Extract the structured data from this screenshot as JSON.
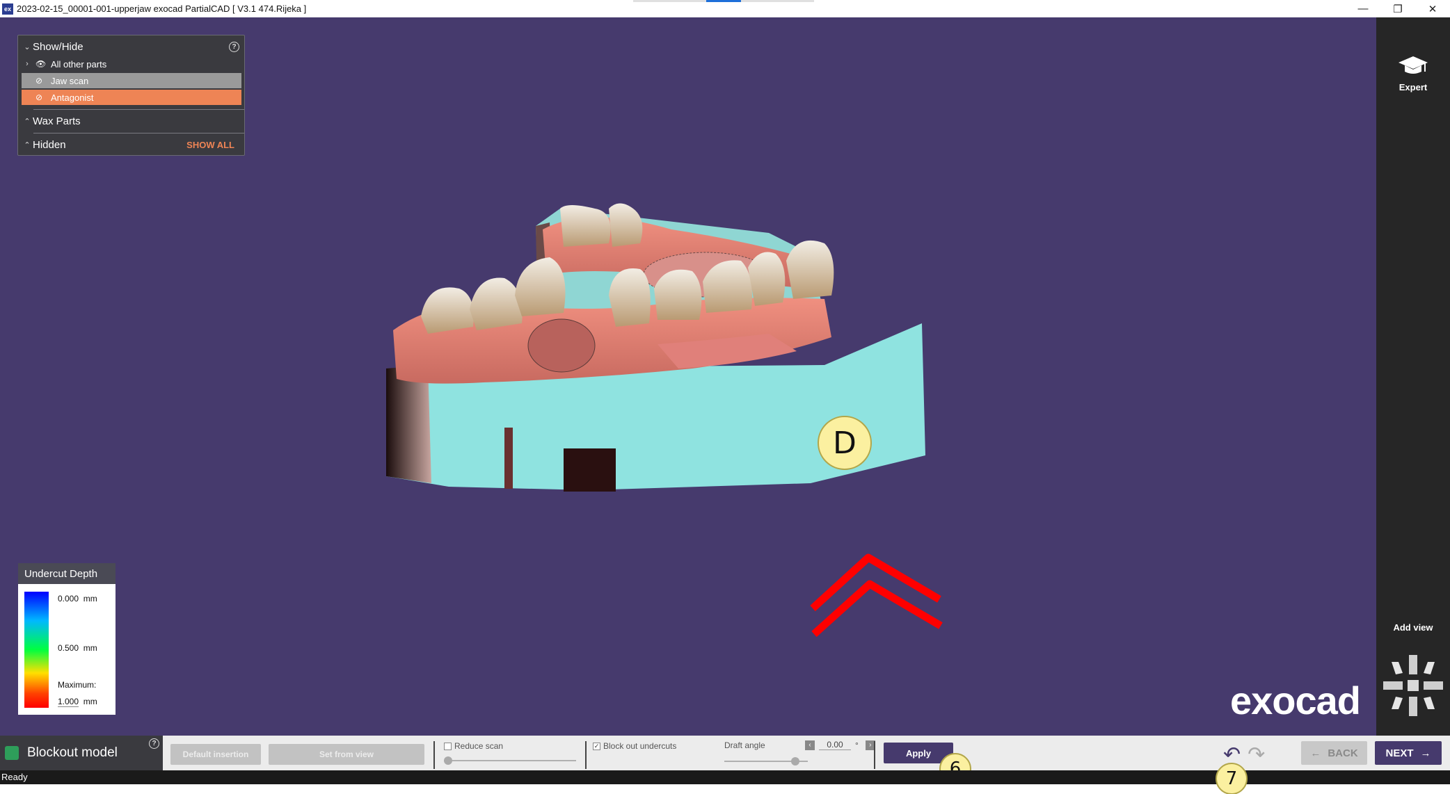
{
  "window": {
    "title": "2023-02-15_00001-001-upperjaw exocad PartialCAD [ V3.1 474.Rijeka ]",
    "app_icon_text": "ex",
    "minimize_label": "—",
    "maximize_label": "❐",
    "close_label": "✕"
  },
  "show_hide": {
    "header": "Show/Hide",
    "help_label": "?",
    "items": [
      {
        "label": "All other parts",
        "icon": "eye-icon"
      },
      {
        "label": "Jaw scan",
        "icon": "eye-hidden-icon"
      },
      {
        "label": "Antagonist",
        "icon": "eye-hidden-icon"
      }
    ],
    "wax_parts": "Wax Parts",
    "hidden": "Hidden",
    "show_all": "SHOW ALL"
  },
  "undercut_legend": {
    "title": "Undercut Depth",
    "min_value": "0.000",
    "mid_value": "0.500",
    "unit": "mm",
    "maximum_label": "Maximum:",
    "max_value": "1.000"
  },
  "markers": {
    "d": "D",
    "six": "6",
    "seven": "7"
  },
  "sidebar": {
    "expert_label": "Expert",
    "add_view_label": "Add view"
  },
  "logo": "exocad",
  "toolbar": {
    "tool_name": "Blockout model",
    "help_label": "?",
    "default_insertion": "Default insertion",
    "set_from_view": "Set from view",
    "reduce_scan": "Reduce scan",
    "block_out_undercuts": "Block out undercuts",
    "block_out_checked": "✓",
    "draft_angle": "Draft angle",
    "draft_value": "0.00",
    "draft_unit": "°",
    "apply": "Apply",
    "back": "BACK",
    "next": "NEXT"
  },
  "status": "Ready",
  "colors": {
    "viewport": "#463a6d",
    "accent_orange": "#ee8455",
    "jaw_scan_row": "#9a9a9a",
    "marker_fill": "#fbf0a0",
    "chevron_red": "#ff0000"
  }
}
